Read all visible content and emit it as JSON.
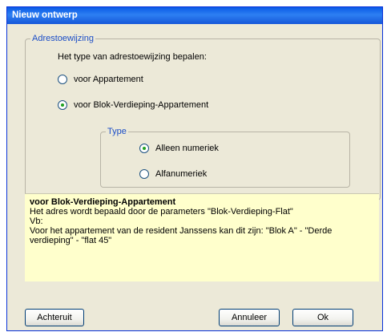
{
  "window": {
    "title": "Nieuw ontwerp"
  },
  "address_group": {
    "legend": "Adrestoewijzing",
    "prompt": "Het type van adrestoewijzing bepalen:",
    "options": [
      {
        "label": "voor Appartement",
        "checked": false
      },
      {
        "label": "voor Blok-Verdieping-Appartement",
        "checked": true
      }
    ]
  },
  "type_group": {
    "legend": "Type",
    "options": [
      {
        "label": "Alleen numeriek",
        "checked": true
      },
      {
        "label": "Alfanumeriek",
        "checked": false
      }
    ]
  },
  "info": {
    "title": "voor Blok-Verdieping-Appartement",
    "line1": "Het adres wordt bepaald door de parameters \"Blok-Verdieping-Flat\"",
    "line2": "Vb:",
    "line3": "Voor het appartement van de resident Janssens kan dit zijn: \"Blok A\" - \"Derde",
    "line4": "verdieping\" - \"flat 45\""
  },
  "buttons": {
    "back": "Achteruit",
    "cancel": "Annuleer",
    "ok": "Ok"
  },
  "colors": {
    "title_bar": "#0a5ae6",
    "dialog_bg": "#ece9d8",
    "legend_text": "#1c4ec7",
    "info_bg": "#ffffcc",
    "radio_dot": "#21a121"
  }
}
